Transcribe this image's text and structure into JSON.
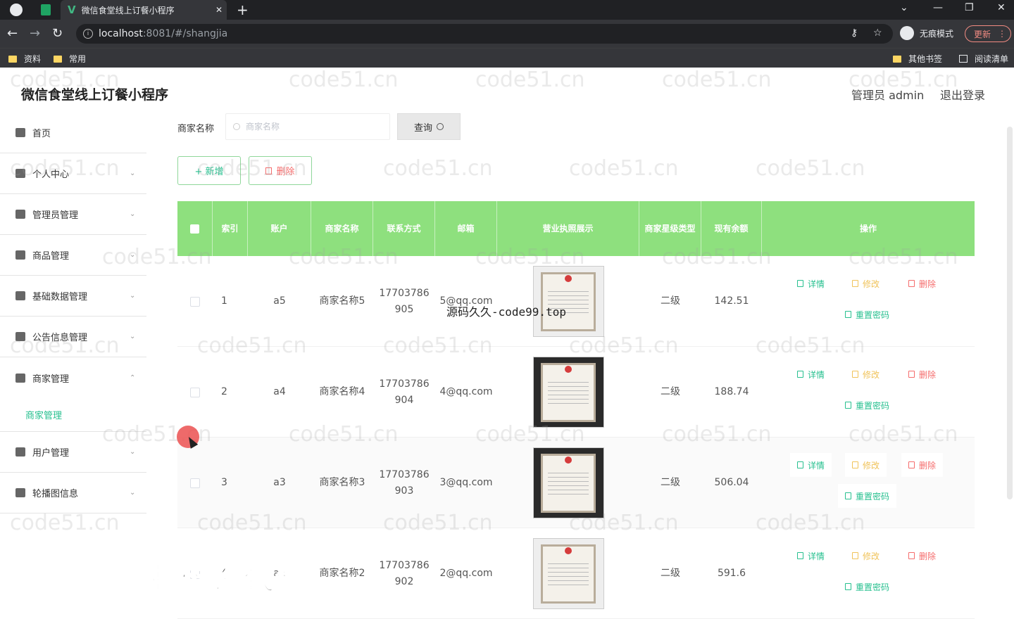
{
  "browser": {
    "tab_title": "微信食堂线上订餐小程序",
    "tab_close": "✕",
    "new_tab": "+",
    "url_host": "localhost",
    "url_rest": ":8081/#/shangjia",
    "incognito_label": "无痕模式",
    "update_label": "更新",
    "bookmarks": [
      "资料",
      "常用"
    ],
    "other_bookmarks": "其他书签",
    "reading_list": "阅读清单"
  },
  "header": {
    "title": "微信食堂线上订餐小程序",
    "admin": "管理员 admin",
    "logout": "退出登录"
  },
  "sidebar": {
    "items": [
      {
        "label": "首页",
        "arrow": ""
      },
      {
        "label": "个人中心",
        "arrow": "⌄"
      },
      {
        "label": "管理员管理",
        "arrow": "⌄"
      },
      {
        "label": "商品管理",
        "arrow": "⌄"
      },
      {
        "label": "基础数据管理",
        "arrow": "⌄"
      },
      {
        "label": "公告信息管理",
        "arrow": "⌄"
      },
      {
        "label": "商家管理",
        "arrow": "⌃"
      },
      {
        "label": "用户管理",
        "arrow": "⌄"
      },
      {
        "label": "轮播图信息",
        "arrow": "⌄"
      }
    ],
    "submenu_active": "商家管理"
  },
  "search": {
    "label": "商家名称",
    "placeholder": "商家名称",
    "button": "查询"
  },
  "actions": {
    "add": "+ 新增",
    "delete": "删除"
  },
  "table": {
    "headers": [
      "索引",
      "账户",
      "商家名称",
      "联系方式",
      "邮箱",
      "营业执照展示",
      "商家星级类型",
      "现有余额",
      "操作"
    ],
    "rows": [
      {
        "index": "1",
        "account": "a5",
        "name": "商家名称5",
        "phone": "17703786905",
        "email": "5@qq.com",
        "level": "二级",
        "balance": "142.51"
      },
      {
        "index": "2",
        "account": "a4",
        "name": "商家名称4",
        "phone": "17703786904",
        "email": "4@qq.com",
        "level": "二级",
        "balance": "188.74"
      },
      {
        "index": "3",
        "account": "a3",
        "name": "商家名称3",
        "phone": "17703786903",
        "email": "3@qq.com",
        "level": "二级",
        "balance": "506.04"
      },
      {
        "index": "4",
        "account": "a2",
        "name": "商家名称2",
        "phone": "17703786902",
        "email": "2@qq.com",
        "level": "二级",
        "balance": "591.6"
      }
    ],
    "ops": {
      "detail": "详情",
      "edit": "修改",
      "remove": "删除",
      "reset": "重置密码"
    }
  },
  "overlay": {
    "watermark": "code51.cn",
    "source_text": "源码久久-code99.top",
    "promo_text": "专业毕设代做"
  }
}
